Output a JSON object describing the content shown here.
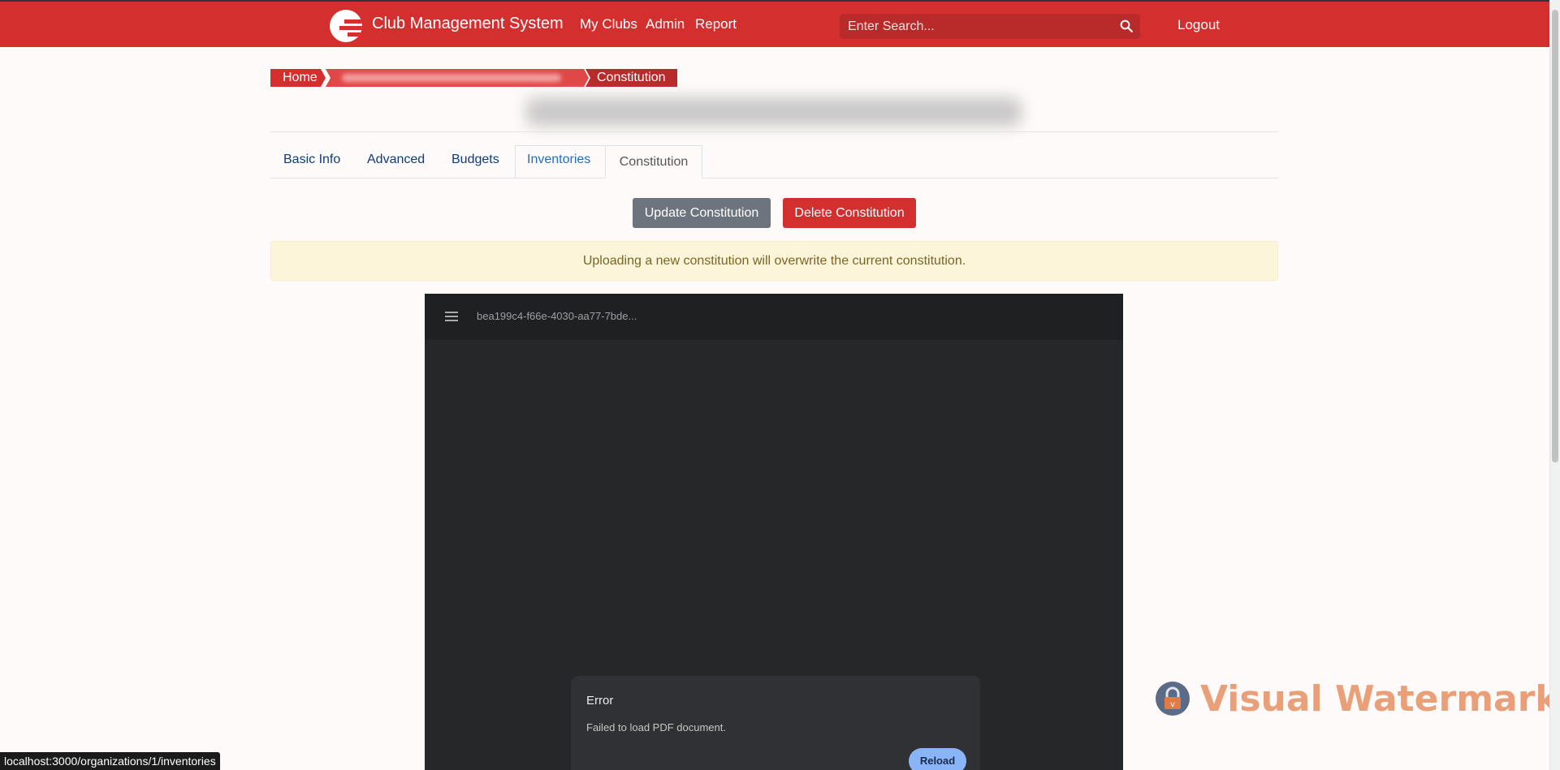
{
  "header": {
    "brand": "Club Management System",
    "nav": [
      "My Clubs",
      "Admin",
      "Report"
    ],
    "search_placeholder": "Enter Search...",
    "logout": "Logout"
  },
  "breadcrumb": {
    "home": "Home",
    "current": "Constitution"
  },
  "tabs": {
    "basic_info": "Basic Info",
    "advanced": "Advanced",
    "budgets": "Budgets",
    "inventories": "Inventories",
    "constitution": "Constitution"
  },
  "actions": {
    "update": "Update Constitution",
    "delete": "Delete Constitution"
  },
  "alert": "Uploading a new constitution will overwrite the current constitution.",
  "viewer": {
    "file_name": "bea199c4-f66e-4030-aa77-7bde...",
    "error_title": "Error",
    "error_message": "Failed to load PDF document.",
    "reload": "Reload"
  },
  "watermark": "Visual Watermark",
  "status_url": "localhost:3000/organizations/1/inventories",
  "colors": {
    "primary": "#d32f2f",
    "secondary": "#6c757d",
    "alert_bg": "#fcf5da",
    "viewer_bg": "#262729"
  }
}
